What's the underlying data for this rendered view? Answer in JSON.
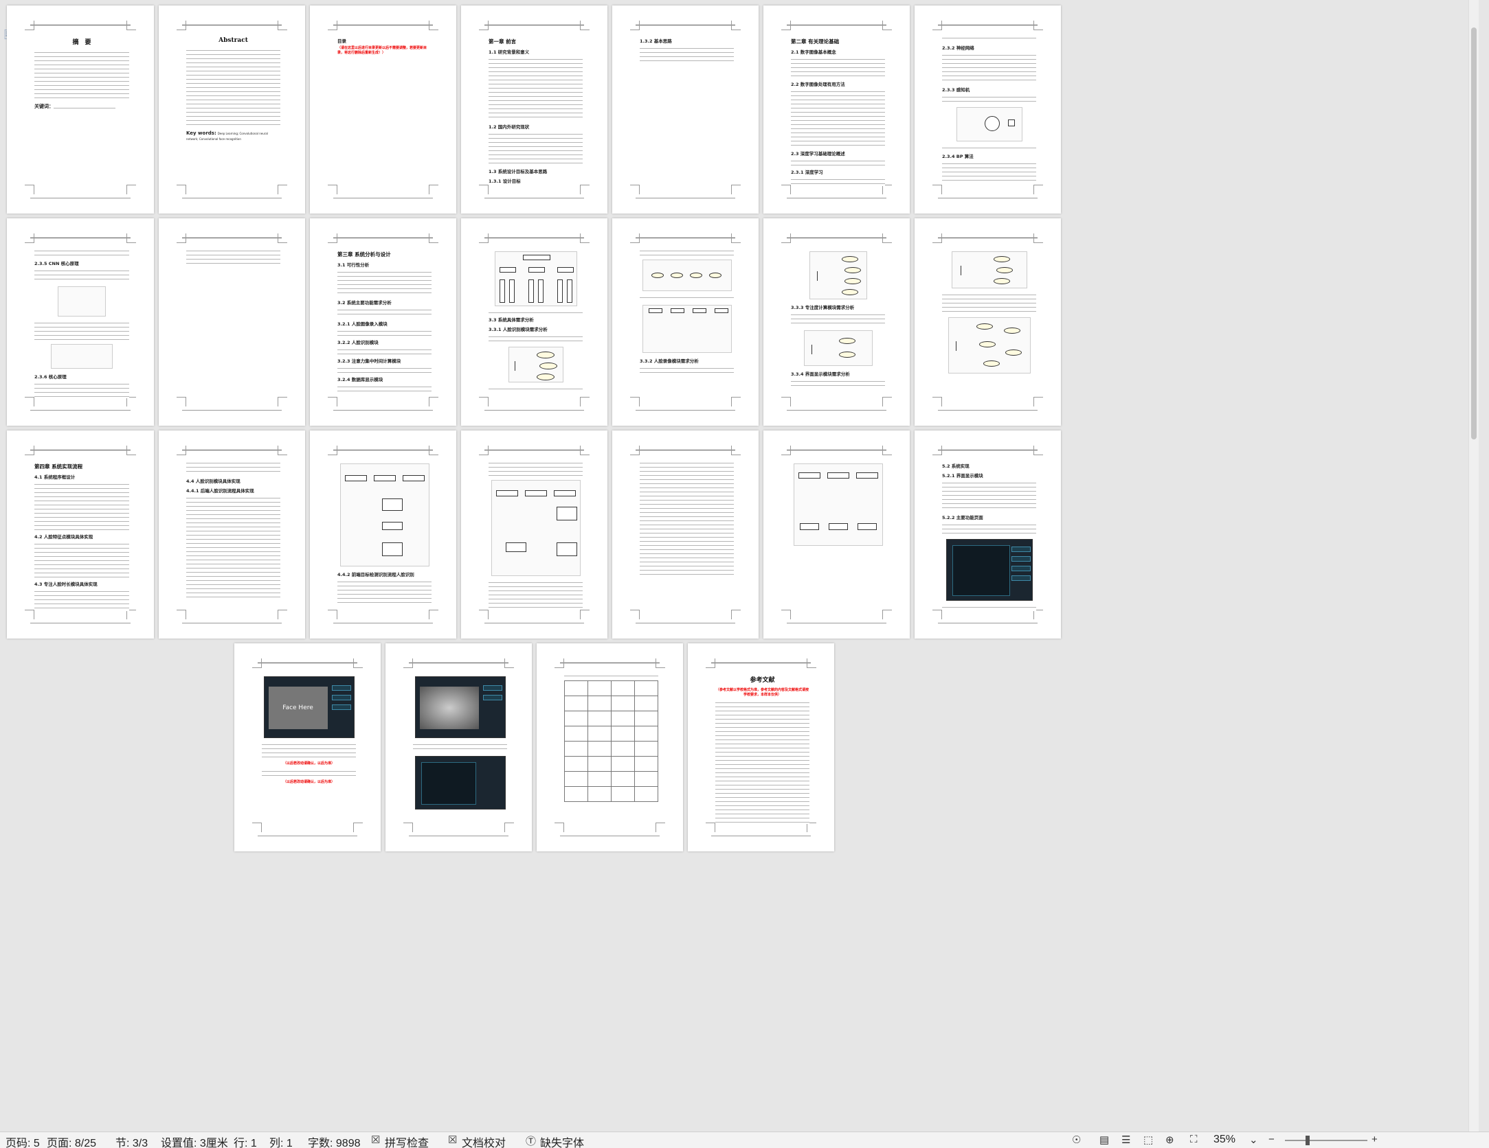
{
  "status": {
    "page_num": "页码: 5",
    "page_of": "页面: 8/25",
    "section": "节: 3/3",
    "setting": "设置值: 3厘米",
    "row": "行: 1",
    "col": "列: 1",
    "word_count": "字数: 9898",
    "spell_check": "拼写检查",
    "doc_proof": "文档校对",
    "missing_font": "缺失字体",
    "zoom": "35%"
  },
  "pages": {
    "p1": {
      "title": "摘　要",
      "keywords": "关键词："
    },
    "p2": {
      "title": "Abstract",
      "keywords": "Key  words:",
      "keywords_text": "Deep Learning; Convolutional neural network; Convolutional face recognition"
    },
    "p3": {
      "title": "目录",
      "red_note": "（请在这里以后进行目录更新以后不需要调整，若要更新目录，将这行删除后重新生成！）"
    },
    "p4": {
      "h1": "第一章  前言",
      "s1": "1.1  研究背景和意义",
      "s2": "1.2  国内外研究现状",
      "s3": "1.3  系统设计目标及基本思路",
      "s4": "1.3.1  设计目标"
    },
    "p5": {
      "s1": "1.3.2  基本思路"
    },
    "p6": {
      "h1": "第二章  有关理论基础",
      "s1": "2.1 数字图像基本概念",
      "s2": "2.2 数字图像处理有用方法",
      "s3": "2.3  深度学习基础理论概述",
      "s4": "2.3.1  深度学习"
    },
    "p7": {
      "s1": "2.3.2  神经网络",
      "s2": "2.3.3  感知机",
      "s3": "2.3.4 BP 算法"
    },
    "p8": {
      "s1": "2.3.5 CNN 核心原理",
      "s2": "2.3.6  核心原理"
    },
    "p10": {
      "h1": "第三章  系统分析与设计",
      "s1": "3.1 可行性分析",
      "s2": "3.2 系统主要功能需求分析",
      "s3": "3.2.1 人脸图像录入模块",
      "s4": "3.2.2 人脸识别模块",
      "s5": "3.2.3 注意力集中时间计算模块",
      "s6": "3.2.4 数据库显示模块"
    },
    "p11": {
      "s1": "3.3 系统具体需求分析",
      "s2": "3.3.1 人脸识别模块需求分析"
    },
    "p12": {
      "s1": "3.3.2 人脸录像模块需求分析"
    },
    "p13": {
      "s1": "3.3.3 专注度计算模块需求分析",
      "s2": "3.3.4 界面显示模块需求分析"
    },
    "p15": {
      "h1": "第四章  系统实现流程",
      "s1": "4.1  系统程序框设计",
      "s2": "4.2  人脸特征点模块具体实现",
      "s3": "4.3  专注人脸时长模块具体实现"
    },
    "p16": {
      "s1": "4.4 人脸识别模块具体实现",
      "s2": "4.4.1 后端人脸识别流程具体实现"
    },
    "p17": {
      "s1": "4.4.2 前端目标检测识别流程人脸识别"
    },
    "p21": {
      "s1": "5.2  系统实现",
      "s2": "5.2.1 界面显示模块",
      "s3": "5.2.2 主要功能页面"
    },
    "p22": {
      "face_label": "Face Here",
      "red1": "（以后若改动请确认，以后为准）",
      "red2": "（以后若改动请确认，以后为准）"
    },
    "p25": {
      "title": "参考文献",
      "red_note": "（参考文献以学校格式为准，参考文献的内容及文献格式请按学校要求，本样本仅供）"
    }
  }
}
